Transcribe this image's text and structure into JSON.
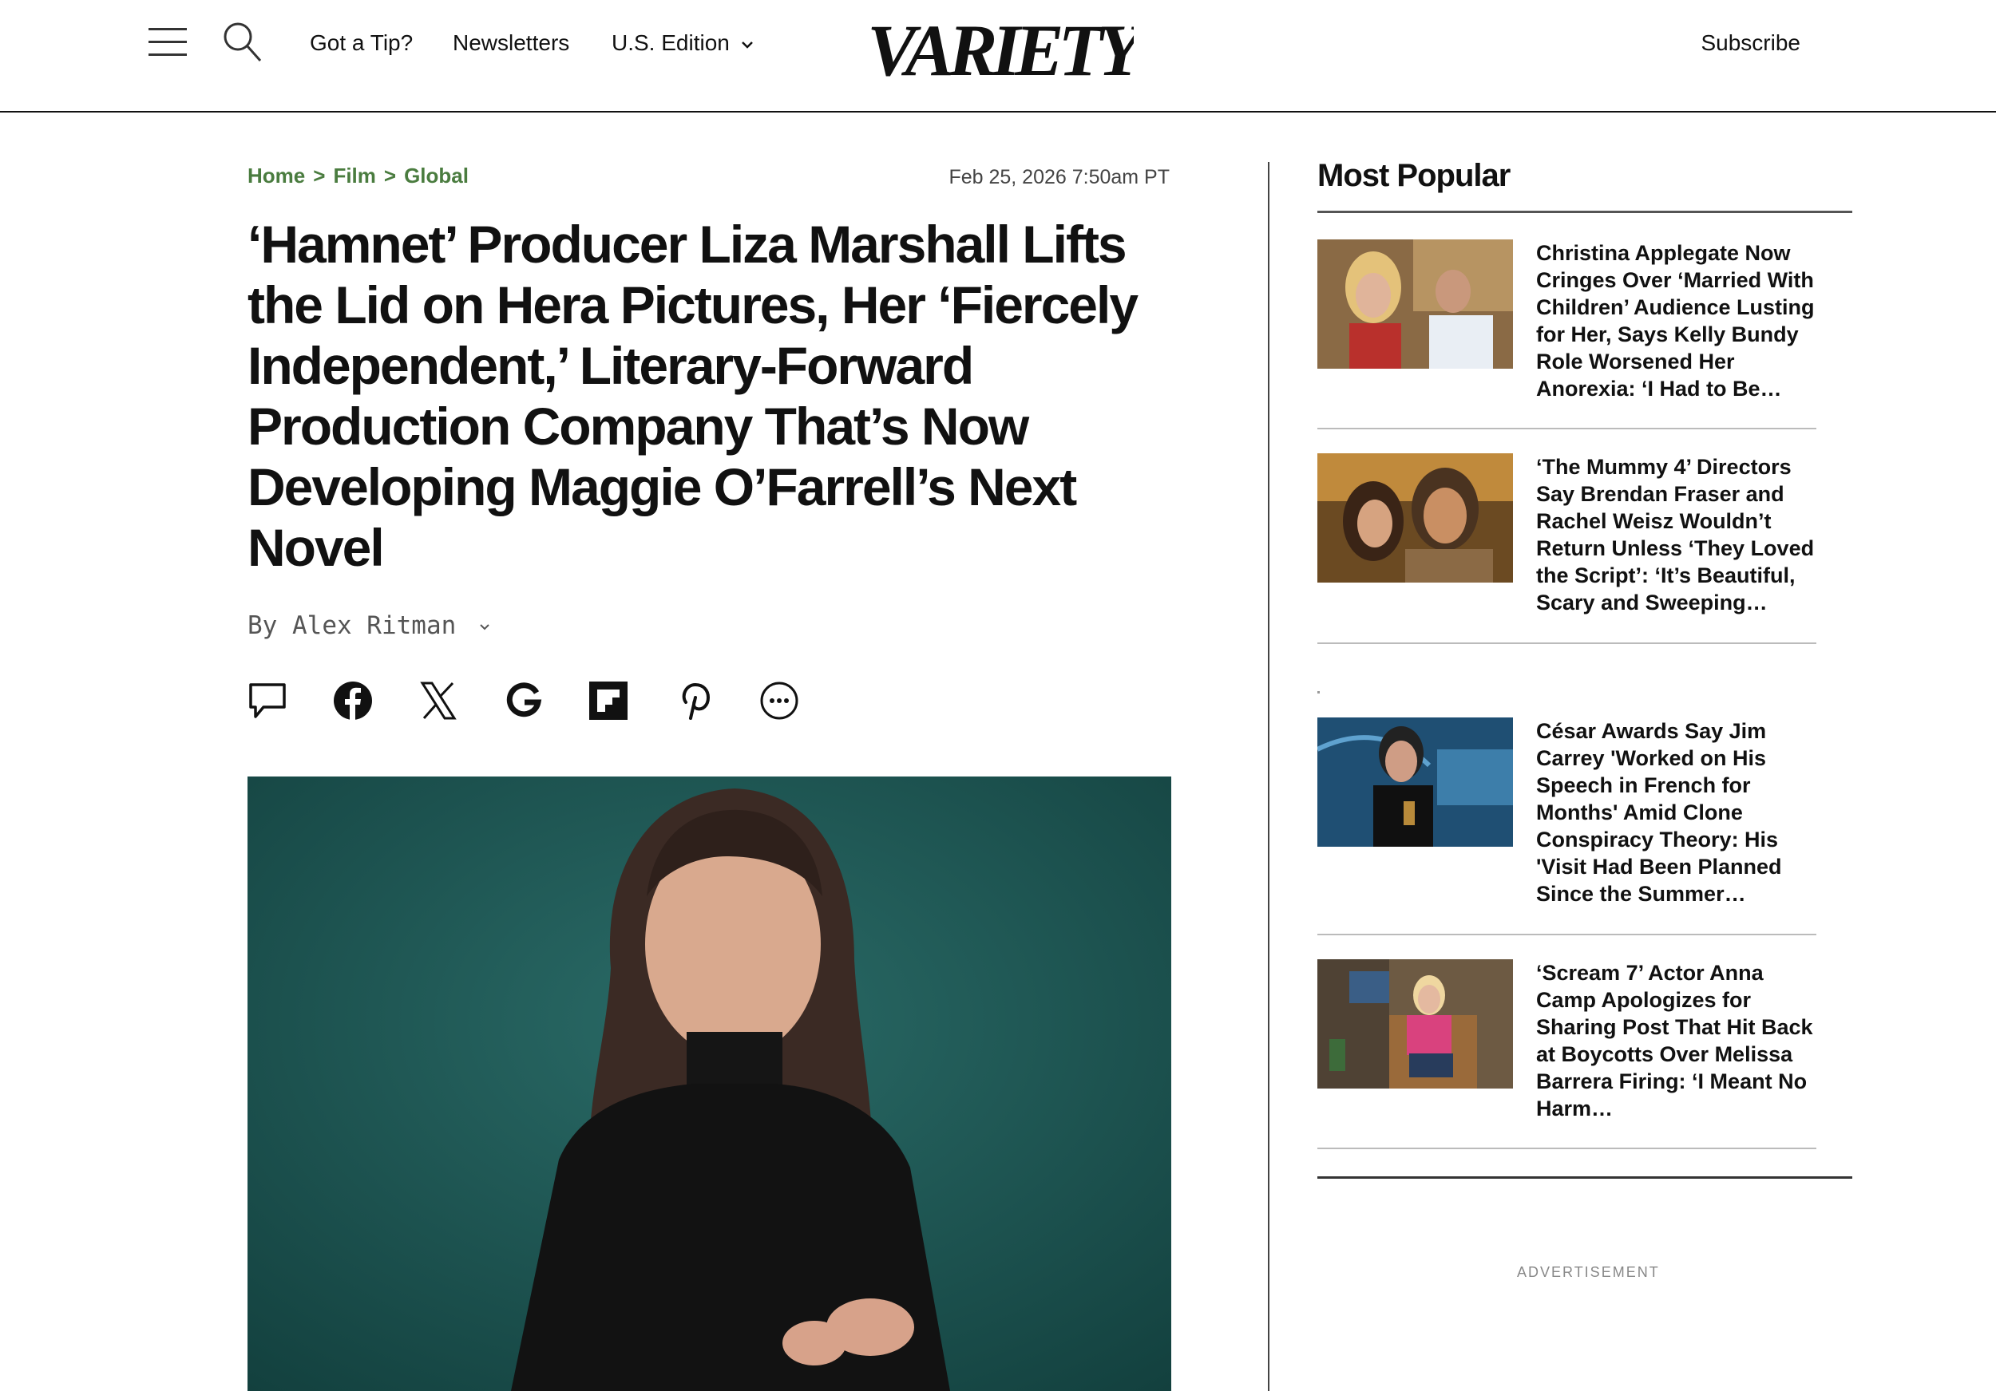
{
  "header": {
    "nav": [
      "Got a Tip?",
      "Newsletters",
      "U.S. Edition"
    ],
    "logo_text": "VARIETY",
    "subscribe": "Subscribe"
  },
  "article": {
    "breadcrumb": [
      "Home",
      "Film",
      "Global"
    ],
    "breadcrumb_sep": ">",
    "date": "Feb 25, 2026 7:50am PT",
    "headline_lines": [
      "‘Hamnet’ Producer Liza Marshall Lifts",
      "the Lid on Hera Pictures, Her ‘Fiercely",
      "Independent,’ Literary-Forward",
      "Production Company That’s Now",
      "Developing Maggie O’Farrell’s Next",
      "Novel"
    ],
    "byline": "By Alex Ritman",
    "share_icons": [
      "comment-icon",
      "facebook-icon",
      "x-icon",
      "google-icon",
      "flipboard-icon",
      "pinterest-icon",
      "more-icon"
    ]
  },
  "sidebar": {
    "title": "Most Popular",
    "items": [
      {
        "text": "Christina Applegate Now Cringes Over ‘Married With Children’ Audience Lusting for Her, Says Kelly Bundy Role Worsened Her Anorexia: ‘I Had to Be…"
      },
      {
        "text": "‘The Mummy 4’ Directors Say Brendan Fraser and Rachel Weisz Wouldn’t Return Unless ‘They Loved the Script’: ‘It’s Beautiful, Scary and Sweeping…"
      },
      {
        "text": "César Awards Say Jim Carrey 'Worked on His Speech in French for Months' Amid Clone Conspiracy Theory: His 'Visit Had Been Planned Since the Summer…"
      },
      {
        "text": "‘Scream 7’ Actor Anna Camp Apologizes for Sharing Post That Hit Back at Boycotts Over Melissa Barrera Firing: ‘I Meant No Harm…"
      }
    ],
    "advertisement": "ADVERTISEMENT"
  },
  "colors": {
    "breadcrumb": "#4a7c3f",
    "hero_bg": "#1d5754"
  }
}
